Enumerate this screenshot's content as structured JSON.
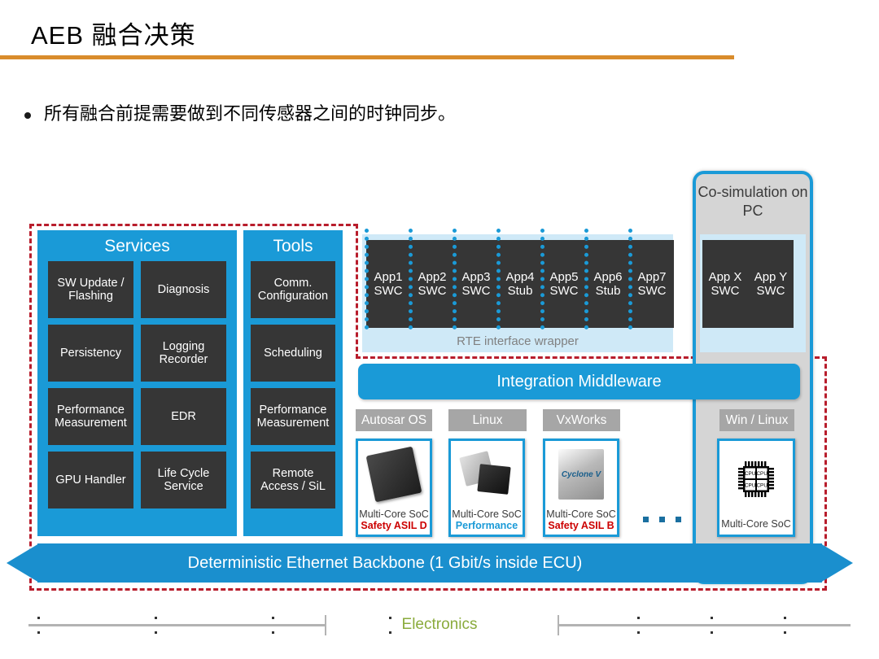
{
  "slide": {
    "title": "AEB 融合决策",
    "rule_color": "#d98c2c",
    "bullets": [
      "所有融合前提需要做到不同传感器之间的时钟同步。"
    ]
  },
  "diagram": {
    "accent_blue": "#1a9ad7",
    "dark_block": "#363636",
    "boundary_color": "#b81d2c",
    "services_panel": {
      "title": "Services",
      "cells": [
        "SW Update / Flashing",
        "Diagnosis",
        "Persistency",
        "Logging Recorder",
        "Performance Measurement",
        "EDR",
        "GPU Handler",
        "Life Cycle Service"
      ]
    },
    "tools_panel": {
      "title": "Tools",
      "cells": [
        "Comm. Configuration",
        "Scheduling",
        "Performance Measurement",
        "Remote Access / SiL"
      ]
    },
    "apps": [
      {
        "name": "App1",
        "kind": "SWC"
      },
      {
        "name": "App2",
        "kind": "SWC"
      },
      {
        "name": "App3",
        "kind": "SWC"
      },
      {
        "name": "App4",
        "kind": "Stub"
      },
      {
        "name": "App5",
        "kind": "SWC"
      },
      {
        "name": "App6",
        "kind": "Stub"
      },
      {
        "name": "App7",
        "kind": "SWC"
      }
    ],
    "rte_label": "RTE interface wrapper",
    "cosimulation": {
      "title": "Co-simulation on PC",
      "apps": [
        {
          "name": "App X",
          "kind": "SWC"
        },
        {
          "name": "App Y",
          "kind": "SWC"
        }
      ]
    },
    "middleware_label": "Integration Middleware",
    "os_tags": [
      "Autosar OS",
      "Linux",
      "VxWorks",
      "Win / Linux"
    ],
    "socs": [
      {
        "name": "Multi-Core SoC",
        "sub": "Safety ASIL D",
        "sub_color": "#cc0000"
      },
      {
        "name": "Multi-Core SoC",
        "sub": "Performance",
        "sub_color": "#1a9ad7"
      },
      {
        "name": "Multi-Core SoC",
        "sub": "Safety ASIL B",
        "sub_color": "#cc0000"
      },
      {
        "name": "Multi-Core SoC",
        "sub": "",
        "sub_color": "#cc0000"
      }
    ],
    "cpu_glyph_label": "CPU",
    "ellipsis": "• • •",
    "backbone_label": "Deterministic Ethernet Backbone (1 Gbit/s inside  ECU)"
  },
  "footer": {
    "label": "Electronics",
    "label_color": "#8aab3c"
  }
}
